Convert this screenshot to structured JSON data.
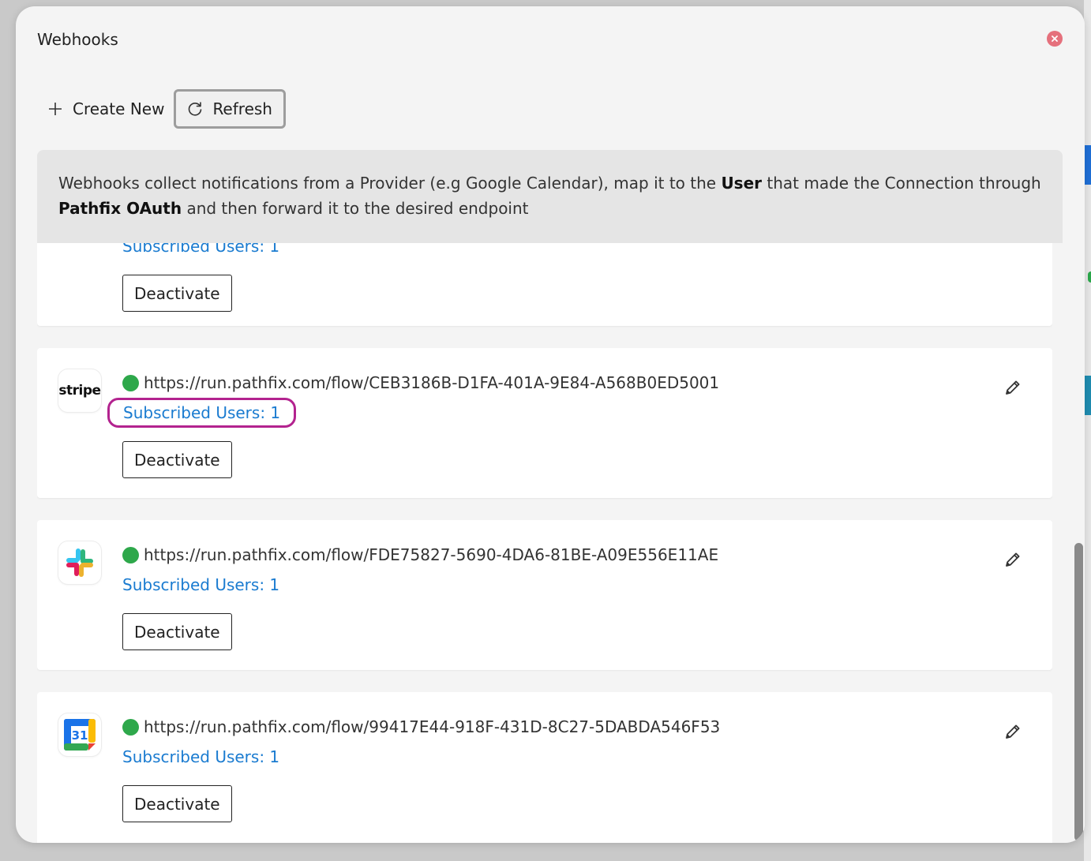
{
  "modal": {
    "title": "Webhooks",
    "close_icon": "close-icon"
  },
  "toolbar": {
    "create_label": "Create New",
    "refresh_label": "Refresh"
  },
  "info": {
    "part1": "Webhooks collect notifications from a Provider (e.g Google Calendar), map it to the ",
    "bold1": "User",
    "part2": " that made the Connection through ",
    "bold2": "Pathfix OAuth",
    "part3": " and then forward it to the desired endpoint"
  },
  "partial_card": {
    "subscribed": "Subscribed Users: 1",
    "deactivate_label": "Deactivate"
  },
  "webhooks": [
    {
      "provider": "stripe",
      "logo_text": "stripe",
      "url": "https://run.pathfix.com/flow/CEB3186B-D1FA-401A-9E84-A568B0ED5001",
      "subscribed": "Subscribed Users: 1",
      "deactivate_label": "Deactivate",
      "status_color": "#2ea84b"
    },
    {
      "provider": "slack",
      "url": "https://run.pathfix.com/flow/FDE75827-5690-4DA6-81BE-A09E556E11AE",
      "subscribed": "Subscribed Users: 1",
      "deactivate_label": "Deactivate",
      "status_color": "#2ea84b"
    },
    {
      "provider": "google-calendar",
      "logo_text": "31",
      "url": "https://run.pathfix.com/flow/99417E44-918F-431D-8C27-5DABDA546F53",
      "subscribed": "Subscribed Users: 1",
      "deactivate_label": "Deactivate",
      "status_color": "#2ea84b"
    }
  ],
  "colors": {
    "link": "#1a7bd0",
    "highlight": "#b3238f",
    "status_active": "#2ea84b",
    "close": "#e5707c"
  }
}
